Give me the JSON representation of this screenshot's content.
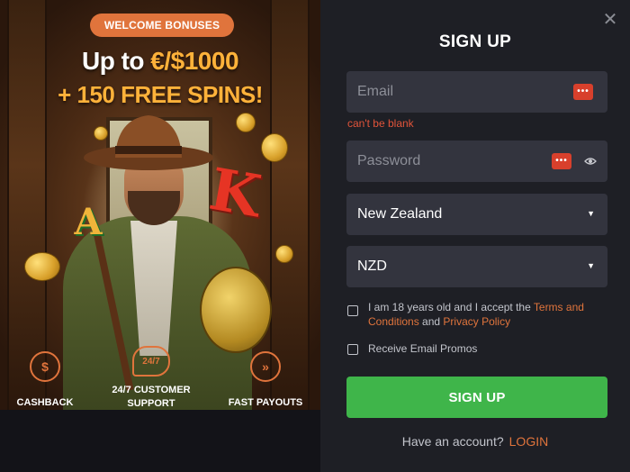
{
  "promo": {
    "badge": "WELCOME BONUSES",
    "headline_prefix": "Up to ",
    "headline_amount": "€/$1000",
    "headline_line2": "+ 150 FREE SPINS!",
    "features": [
      {
        "label": "CASHBACK",
        "icon": "cashback-icon",
        "icon_text": "$"
      },
      {
        "label": "24/7 CUSTOMER SUPPORT",
        "icon": "support-chat-icon",
        "icon_text": "24/7"
      },
      {
        "label": "FAST PAYOUTS",
        "icon": "fast-forward-icon",
        "icon_text": "»"
      }
    ]
  },
  "form": {
    "title": "SIGN UP",
    "email_placeholder": "Email",
    "email_error": "can't be blank",
    "password_placeholder": "Password",
    "password_manager_label": "•••",
    "country": "New Zealand",
    "currency": "NZD",
    "terms_prefix": "I am 18 years old and I accept the ",
    "terms_link": "Terms and Conditions",
    "terms_and": " and ",
    "privacy_link": "Privacy Policy",
    "promos_label": "Receive Email Promos",
    "submit_label": "SIGN UP",
    "have_account": "Have an account?",
    "login_label": "LOGIN"
  },
  "colors": {
    "accent": "#e0743c",
    "submit": "#3fb54a",
    "panel": "#1e1f25",
    "field": "#33343e",
    "error": "#e2543a"
  }
}
